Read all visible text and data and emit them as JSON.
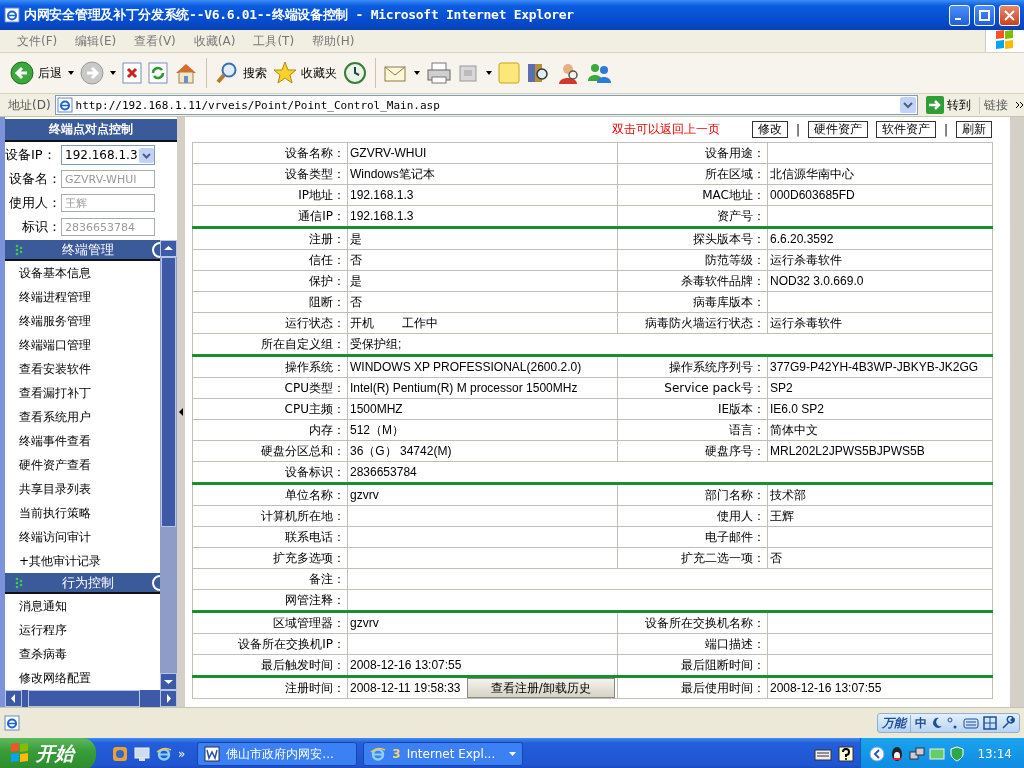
{
  "window": {
    "title": "内网安全管理及补丁分发系统--V6.6.01--终端设备控制 - Microsoft Internet Explorer"
  },
  "menu": [
    "文件(F)",
    "编辑(E)",
    "查看(V)",
    "收藏(A)",
    "工具(T)",
    "帮助(H)"
  ],
  "toolbar": {
    "back": "后退",
    "search": "搜索",
    "favorites": "收藏夹"
  },
  "address": {
    "label": "地址(D)",
    "url": "http://192.168.1.11/vrveis/Point/Point_Control_Main.asp",
    "go": "转到",
    "links": "链接"
  },
  "sidebar": {
    "title": "终端点对点控制",
    "fields": [
      {
        "label": "设备IP：",
        "value": "192.168.1.3",
        "kind": "select"
      },
      {
        "label": "设备名：",
        "value": "GZVRV-WHUI",
        "kind": "readonly"
      },
      {
        "label": "使用人：",
        "value": "王辉",
        "kind": "readonly"
      },
      {
        "label": "标识：",
        "value": "2836653784",
        "kind": "readonly"
      }
    ],
    "sections": [
      {
        "title": "终端管理",
        "items": [
          "设备基本信息",
          "终端进程管理",
          "终端服务管理",
          "终端端口管理",
          "查看安装软件",
          "查看漏打补丁",
          "查看系统用户",
          "终端事件查看",
          "硬件资产查看",
          "共享目录列表",
          "当前执行策略",
          "终端访问审计",
          "+其他审计记录"
        ]
      },
      {
        "title": "行为控制",
        "items": [
          "消息通知",
          "运行程序",
          "查杀病毒",
          "修改网络配置"
        ]
      }
    ]
  },
  "header": {
    "hint": "双击可以返回上一页",
    "items": [
      {
        "kind": "button",
        "label": "修改"
      },
      {
        "kind": "separator",
        "label": "|"
      },
      {
        "kind": "button",
        "label": "硬件资产"
      },
      {
        "kind": "button",
        "label": "软件资产"
      },
      {
        "kind": "separator",
        "label": "|"
      },
      {
        "kind": "button",
        "label": "刷新"
      }
    ]
  },
  "groups": [
    {
      "rows": [
        {
          "kind": "pair",
          "cells": [
            {
              "label": "设备名称：",
              "value": "GZVRV-WHUI"
            },
            {
              "label": "设备用途："
            }
          ]
        },
        {
          "kind": "pair",
          "cells": [
            {
              "label": "设备类型：",
              "value": "Windows笔记本"
            },
            {
              "label": "所在区域：",
              "value": "北信源华南中心"
            }
          ]
        },
        {
          "kind": "pair",
          "cells": [
            {
              "label": "IP地址：",
              "value": "192.168.1.3"
            },
            {
              "label": "MAC地址：",
              "value": "000D603685FD"
            }
          ]
        },
        {
          "kind": "pair",
          "cells": [
            {
              "label": "通信IP：",
              "value": "192.168.1.3"
            },
            {
              "label": "资产号："
            }
          ]
        }
      ]
    },
    {
      "rows": [
        {
          "kind": "pair",
          "cells": [
            {
              "label": "注册：",
              "value": "是"
            },
            {
              "label": "探头版本号：",
              "value": "6.6.20.3592"
            }
          ]
        },
        {
          "kind": "pair",
          "cells": [
            {
              "label": "信任：",
              "value": "否"
            },
            {
              "label": "防范等级：",
              "value": "运行杀毒软件"
            }
          ]
        },
        {
          "kind": "pair",
          "cells": [
            {
              "label": "保护：",
              "value": "是"
            },
            {
              "label": "杀毒软件品牌：",
              "value": "NOD32 3.0.669.0"
            }
          ]
        },
        {
          "kind": "pair",
          "cells": [
            {
              "label": "阻断：",
              "value": "否"
            },
            {
              "label": "病毒库版本："
            }
          ]
        },
        {
          "kind": "pair",
          "cells": [
            {
              "label": "运行状态：",
              "value": "开机",
              "status": "工作中"
            },
            {
              "label": "病毒防火墙运行状态：",
              "value": "运行杀毒软件"
            }
          ]
        },
        {
          "kind": "wide",
          "cells": [
            {
              "label": "所在自定义组：",
              "value": "受保护组;"
            }
          ]
        }
      ]
    },
    {
      "rows": [
        {
          "kind": "pair",
          "cells": [
            {
              "label": "操作系统：",
              "value": "WINDOWS XP PROFESSIONAL(2600.2.0)"
            },
            {
              "label": "操作系统序列号：",
              "value": "377G9-P42YH-4B3WP-JBKYB-JK2GG"
            }
          ]
        },
        {
          "kind": "pair",
          "cells": [
            {
              "label": "CPU类型：",
              "value": "Intel(R) Pentium(R) M processor 1500MHz"
            },
            {
              "label": "Service pack号：",
              "value": "SP2"
            }
          ]
        },
        {
          "kind": "pair",
          "cells": [
            {
              "label": "CPU主频：",
              "value": "1500MHZ"
            },
            {
              "label": "IE版本：",
              "value": "IE6.0 SP2"
            }
          ]
        },
        {
          "kind": "pair",
          "cells": [
            {
              "label": "内存：",
              "value": "512（M）"
            },
            {
              "label": "语言：",
              "value": "简体中文"
            }
          ]
        },
        {
          "kind": "pair",
          "cells": [
            {
              "label": "硬盘分区总和：",
              "value": "36（G） 34742(M)"
            },
            {
              "label": "硬盘序号：",
              "value": "MRL202L2JPWS5BJPWS5B"
            }
          ]
        },
        {
          "kind": "wide",
          "cells": [
            {
              "label": "设备标识：",
              "value": "2836653784"
            }
          ]
        }
      ]
    },
    {
      "rows": [
        {
          "kind": "pair",
          "cells": [
            {
              "label": "单位名称：",
              "value": "gzvrv"
            },
            {
              "label": "部门名称：",
              "value": "技术部"
            }
          ]
        },
        {
          "kind": "pair",
          "cells": [
            {
              "label": "计算机所在地："
            },
            {
              "label": "使用人：",
              "value": "王辉"
            }
          ]
        },
        {
          "kind": "pair",
          "cells": [
            {
              "label": "联系电话："
            },
            {
              "label": "电子邮件："
            }
          ]
        },
        {
          "kind": "pair",
          "cells": [
            {
              "label": "扩充多选项："
            },
            {
              "label": "扩充二选一项：",
              "value": "否"
            }
          ]
        },
        {
          "kind": "wide",
          "cells": [
            {
              "label": "备注："
            }
          ]
        },
        {
          "kind": "wide",
          "cells": [
            {
              "label": "网管注释："
            }
          ]
        }
      ]
    },
    {
      "rows": [
        {
          "kind": "pair",
          "cells": [
            {
              "label": "区域管理器：",
              "value": "gzvrv"
            },
            {
              "label": "设备所在交换机名称："
            }
          ]
        },
        {
          "kind": "pair",
          "cells": [
            {
              "label": "设备所在交换机IP："
            },
            {
              "label": "端口描述："
            }
          ]
        },
        {
          "kind": "pair",
          "cells": [
            {
              "label": "最后触发时间：",
              "value": "2008-12-16 13:07:55"
            },
            {
              "label": "最后阻断时间："
            }
          ]
        }
      ]
    },
    {
      "rows": [
        {
          "kind": "pair",
          "cells": [
            {
              "label": "注册时间：",
              "value": "2008-12-11 19:58:33",
              "button": "查看注册/卸载历史"
            },
            {
              "label": "最后使用时间：",
              "value": "2008-12-16 13:07:55"
            }
          ]
        }
      ]
    }
  ],
  "ime": {
    "name": "万能",
    "mode": "中"
  },
  "taskbar": {
    "start": "开始",
    "more": "»",
    "tasks": [
      {
        "label": "佛山市政府内网安..."
      },
      {
        "count": "3",
        "label": "Internet Expl..."
      }
    ],
    "clock": "13:14"
  }
}
